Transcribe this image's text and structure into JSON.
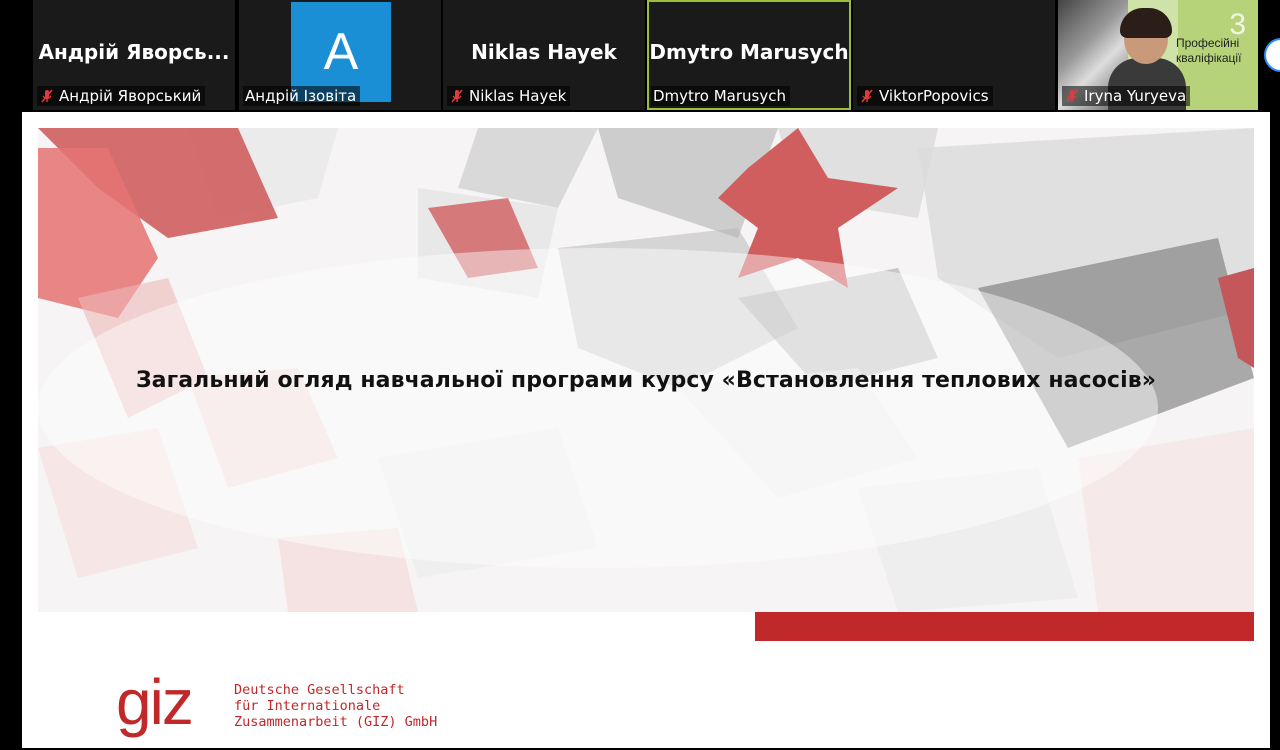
{
  "participants": [
    {
      "display_name": "Андрій Яворсь...",
      "label": "Андрій Яворський",
      "muted": true
    },
    {
      "display_name": "",
      "avatar_letter": "A",
      "label": "Андрій Ізовіта",
      "muted": false
    },
    {
      "display_name": "Niklas Hayek",
      "label": "Niklas Hayek",
      "muted": true
    },
    {
      "display_name": "Dmytro Marusych",
      "label": "Dmytro Marusych",
      "muted": false,
      "active_speaker": true
    },
    {
      "display_name": "",
      "label": "ViktorPopovics",
      "muted": true
    },
    {
      "display_name": "",
      "label": "Iryna Yuryeva",
      "muted": true,
      "video": true,
      "video_background_text": [
        "Професійні",
        "кваліфікації"
      ],
      "video_background_number": "3"
    }
  ],
  "slide": {
    "title": "Загальний огляд навчальної програми курсу «Встановлення теплових насосів»",
    "logo_text": "giz",
    "organization_lines": [
      "Deutsche Gesellschaft",
      "für Internationale",
      "Zusammenarbeit (GIZ) GmbH"
    ]
  },
  "colors": {
    "giz_red": "#c0282a",
    "active_speaker_border": "#9bbf3a",
    "avatar_blue": "#1a8fd6",
    "background": "#000000"
  },
  "icons": {
    "muted": "mic-muted-icon"
  }
}
